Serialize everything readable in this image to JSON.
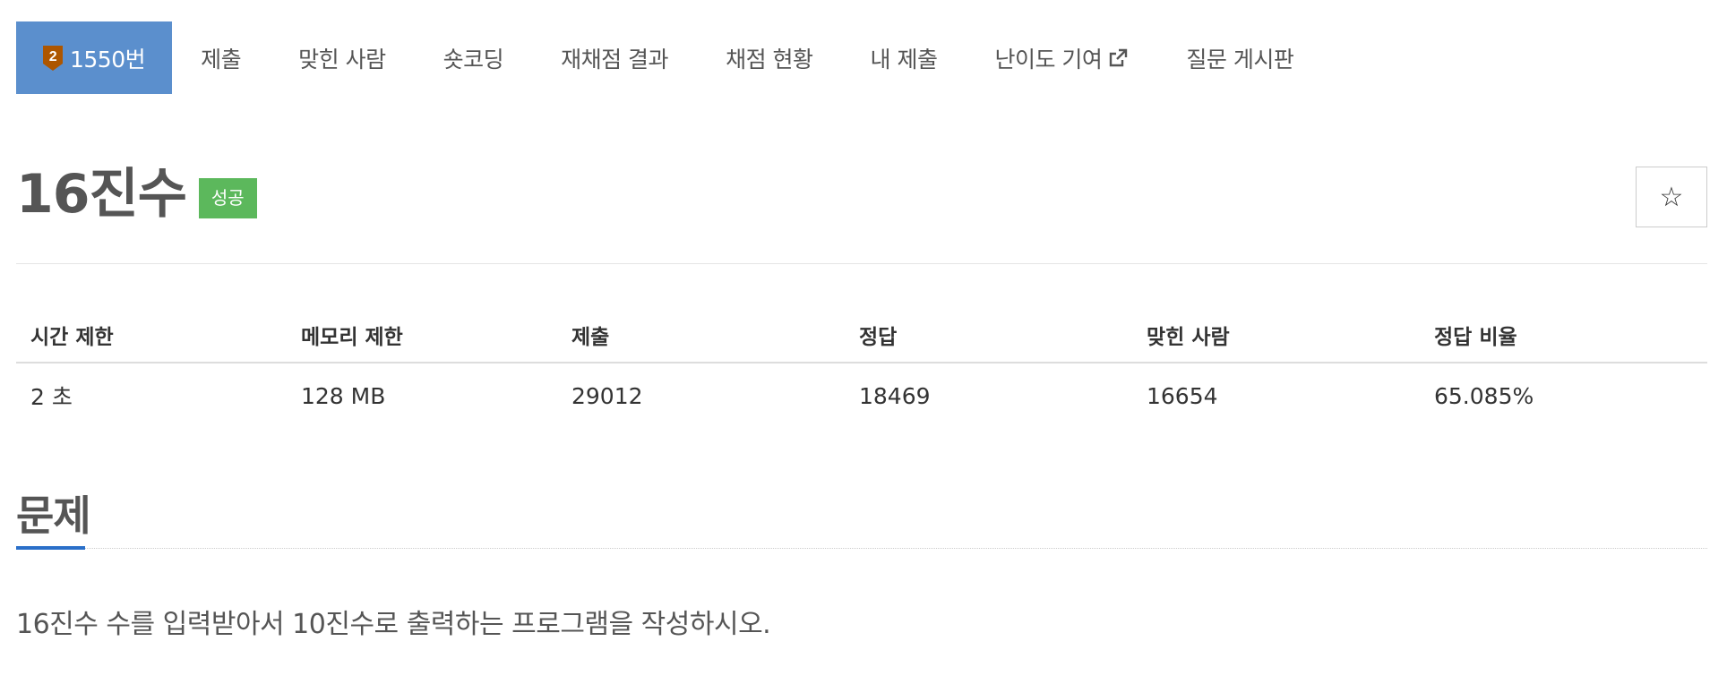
{
  "nav": {
    "problem_tab": {
      "label": "1550번",
      "tier": "2",
      "tier_color": "#ad5600",
      "icon": "tier-badge-icon"
    },
    "items": [
      {
        "label": "제출"
      },
      {
        "label": "맞힌 사람"
      },
      {
        "label": "숏코딩"
      },
      {
        "label": "재채점 결과"
      },
      {
        "label": "채점 현황"
      },
      {
        "label": "내 제출"
      },
      {
        "label": "난이도 기여",
        "icon": "external-link-icon"
      },
      {
        "label": "질문 게시판"
      }
    ],
    "active_color": "#5b8fcd"
  },
  "problem": {
    "title": "16진수",
    "status": "성공",
    "status_color": "#5cb85c",
    "star": "☆"
  },
  "info_table": {
    "headers": [
      "시간 제한",
      "메모리 제한",
      "제출",
      "정답",
      "맞힌 사람",
      "정답 비율"
    ],
    "values": [
      "2 초",
      "128 MB",
      "29012",
      "18469",
      "16654",
      "65.085%"
    ]
  },
  "section": {
    "title": "문제",
    "accent_color": "#2a6fc9",
    "description": "16진수 수를 입력받아서 10진수로 출력하는 프로그램을 작성하시오."
  }
}
